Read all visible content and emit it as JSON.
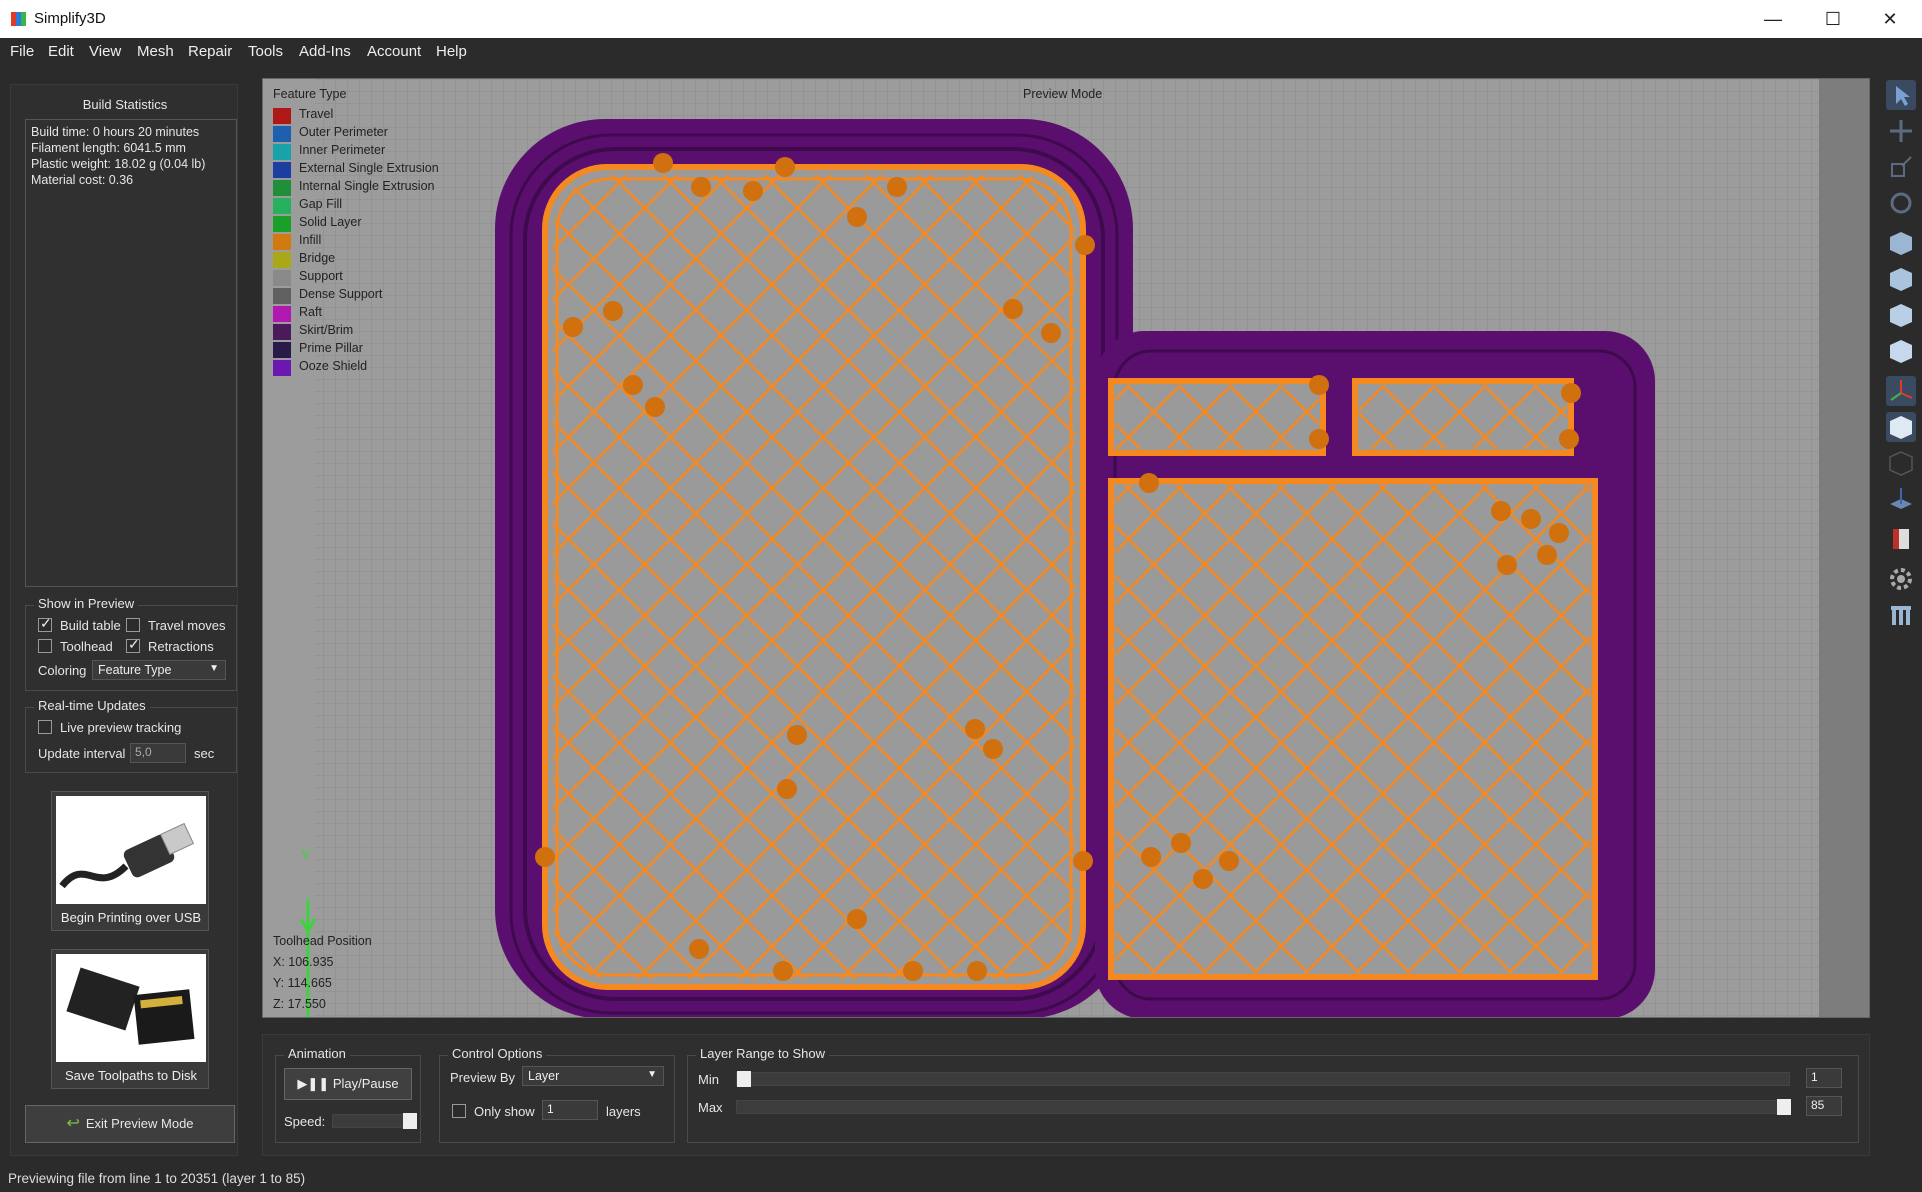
{
  "window": {
    "title": "Simplify3D",
    "minimize": "—",
    "maximize": "☐",
    "close": "✕"
  },
  "menu": [
    "File",
    "Edit",
    "View",
    "Mesh",
    "Repair",
    "Tools",
    "Add-Ins",
    "Account",
    "Help"
  ],
  "build_statistics": {
    "title": "Build Statistics",
    "lines": [
      "Build time: 0 hours 20 minutes",
      "Filament length: 6041.5 mm",
      "Plastic weight: 18.02 g (0.04 lb)",
      "Material cost: 0.36"
    ]
  },
  "show_in_preview": {
    "title": "Show in Preview",
    "build_table": {
      "label": "Build table",
      "checked": true
    },
    "travel_moves": {
      "label": "Travel moves",
      "checked": false
    },
    "toolhead": {
      "label": "Toolhead",
      "checked": false
    },
    "retractions": {
      "label": "Retractions",
      "checked": true
    },
    "coloring_label": "Coloring",
    "coloring_value": "Feature Type"
  },
  "realtime_updates": {
    "title": "Real-time Updates",
    "live_tracking": {
      "label": "Live preview tracking",
      "checked": false
    },
    "update_interval_label": "Update interval",
    "update_interval_value": "5,0",
    "unit": "sec"
  },
  "print_usb_label": "Begin Printing over USB",
  "save_toolpaths_label": "Save Toolpaths to Disk",
  "exit_preview_label": "Exit Preview Mode",
  "viewport": {
    "legend_title": "Feature Type",
    "preview_mode_label": "Preview Mode",
    "axis_y_label": "Y",
    "legend": [
      {
        "label": "Travel",
        "color": "#b01818"
      },
      {
        "label": "Outer Perimeter",
        "color": "#1f5fb0"
      },
      {
        "label": "Inner Perimeter",
        "color": "#19a3a8"
      },
      {
        "label": "External Single Extrusion",
        "color": "#1a3fa0"
      },
      {
        "label": "Internal Single Extrusion",
        "color": "#1f8f3a"
      },
      {
        "label": "Gap Fill",
        "color": "#27b05e"
      },
      {
        "label": "Solid Layer",
        "color": "#18a028"
      },
      {
        "label": "Infill",
        "color": "#d07a10"
      },
      {
        "label": "Bridge",
        "color": "#a8a818"
      },
      {
        "label": "Support",
        "color": "#8a8a8a"
      },
      {
        "label": "Dense Support",
        "color": "#606060"
      },
      {
        "label": "Raft",
        "color": "#b018b0"
      },
      {
        "label": "Skirt/Brim",
        "color": "#4a1a5a"
      },
      {
        "label": "Prime Pillar",
        "color": "#2a1a4a"
      },
      {
        "label": "Ooze Shield",
        "color": "#6a18b0"
      }
    ],
    "toolhead_position": {
      "title": "Toolhead Position",
      "x": "X: 106.935",
      "y": "Y: 114.665",
      "z": "Z: 17.550"
    },
    "colors": {
      "infill": "#f5891f",
      "brim": "#5a0f6e",
      "grid_bg": "#9a9a9a"
    }
  },
  "right_toolbar": [
    "select-icon",
    "move-icon",
    "scale-icon",
    "rotate-icon",
    "view-front-icon",
    "view-top-icon",
    "view-side-icon",
    "view-iso-icon",
    "axes-icon",
    "solid-view-icon",
    "wireframe-icon",
    "cross-section-icon",
    "book-icon",
    "settings-icon",
    "columns-icon"
  ],
  "animation": {
    "title": "Animation",
    "play_label": "Play/Pause",
    "speed_label": "Speed:",
    "speed": 1.0
  },
  "control_options": {
    "title": "Control Options",
    "preview_by_label": "Preview By",
    "preview_by_value": "Layer",
    "only_show_label": "Only show",
    "only_show_checked": false,
    "only_show_value": "1",
    "layers_label": "layers"
  },
  "layer_range": {
    "title": "Layer Range to Show",
    "min_label": "Min",
    "max_label": "Max",
    "min_value": "1",
    "max_value": "85",
    "min_fraction": 0.0,
    "max_fraction": 1.0
  },
  "status": "Previewing file from line 1 to 20351 (layer 1 to 85)"
}
